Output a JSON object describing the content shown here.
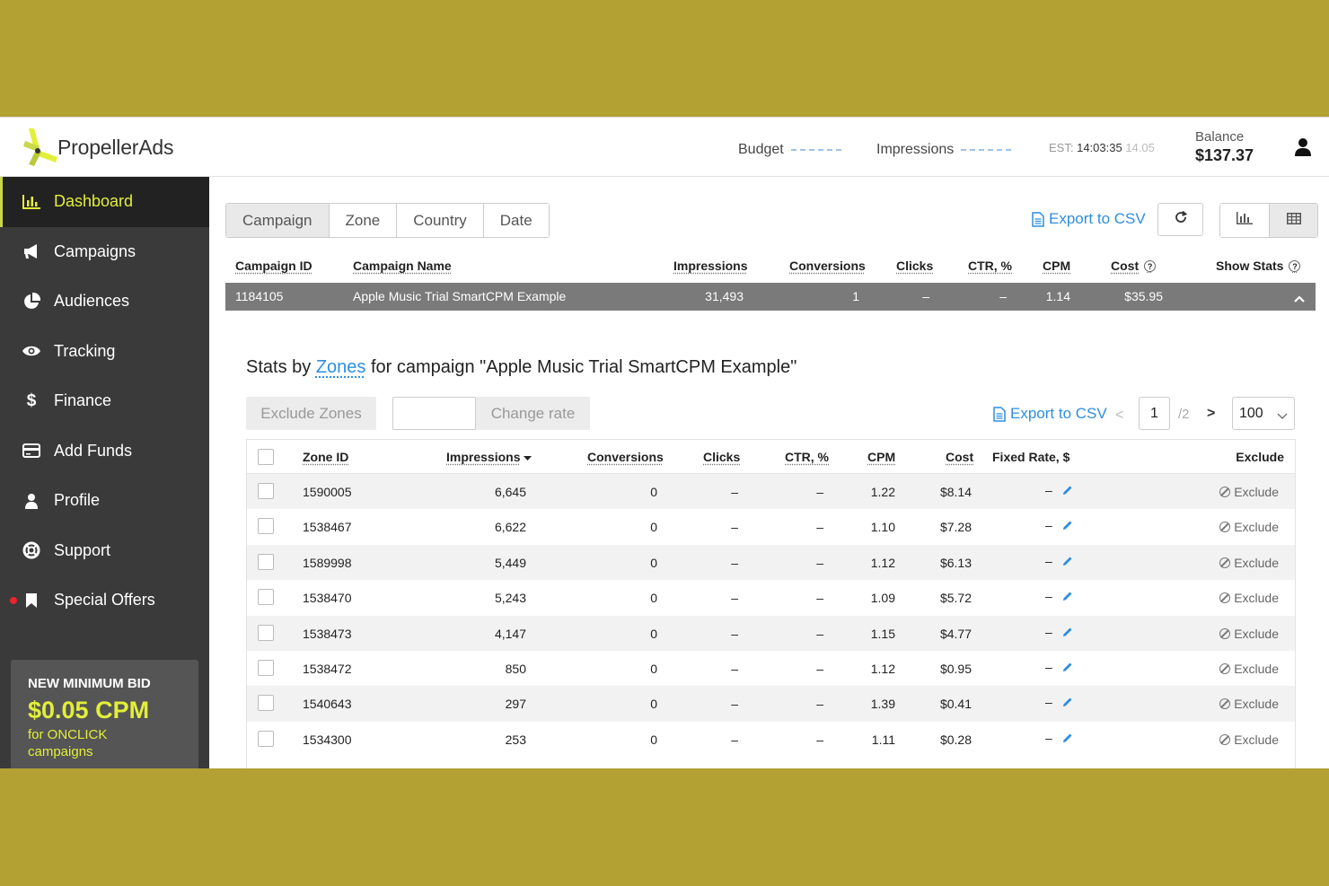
{
  "header": {
    "brand": "PropellerAds",
    "budget_label": "Budget",
    "impressions_label": "Impressions",
    "tz_label": "EST:",
    "time": "14:03:35",
    "date": "14.05",
    "balance_label": "Balance",
    "balance_value": "$137.37"
  },
  "sidebar": {
    "items": [
      {
        "label": "Dashboard",
        "icon": "bar-chart-icon"
      },
      {
        "label": "Campaigns",
        "icon": "megaphone-icon"
      },
      {
        "label": "Audiences",
        "icon": "pie-chart-icon"
      },
      {
        "label": "Tracking",
        "icon": "eye-icon"
      },
      {
        "label": "Finance",
        "icon": "dollar-icon"
      },
      {
        "label": "Add Funds",
        "icon": "credit-card-icon"
      },
      {
        "label": "Profile",
        "icon": "user-icon"
      },
      {
        "label": "Support",
        "icon": "lifebuoy-icon"
      },
      {
        "label": "Special Offers",
        "icon": "bookmark-icon"
      }
    ],
    "promo": {
      "line1": "NEW MINIMUM BID",
      "line2": "$0.05 CPM",
      "line3": "for ONCLICK",
      "line4": "campaigns"
    }
  },
  "toolbar": {
    "tabs": [
      "Campaign",
      "Zone",
      "Country",
      "Date"
    ],
    "active_tab": "Campaign",
    "export_label": "Export to CSV"
  },
  "campaign_table": {
    "headers": {
      "id": "Campaign ID",
      "name": "Campaign Name",
      "impressions": "Impressions",
      "conversions": "Conversions",
      "clicks": "Clicks",
      "ctr": "CTR, %",
      "cpm": "CPM",
      "cost": "Cost",
      "show_stats": "Show Stats",
      "help": "?"
    },
    "row": {
      "id": "1184105",
      "name": "Apple Music Trial SmartCPM Example",
      "impressions": "31,493",
      "conversions": "1",
      "clicks": "–",
      "ctr": "–",
      "cpm": "1.14",
      "cost": "$35.95"
    }
  },
  "stats": {
    "title_prefix": "Stats by",
    "title_link": "Zones",
    "title_suffix": "for campaign \"Apple Music Trial SmartCPM Example\"",
    "exclude_zones_label": "Exclude Zones",
    "rate_value": "",
    "change_rate_label": "Change rate",
    "export_label": "Export to CSV",
    "prev": "<",
    "page": "1",
    "total_pages": "/2",
    "next": ">",
    "per_page": "100"
  },
  "zone_table": {
    "headers": {
      "zone_id": "Zone ID",
      "impressions": "Impressions",
      "conversions": "Conversions",
      "clicks": "Clicks",
      "ctr": "CTR, %",
      "cpm": "CPM",
      "cost": "Cost",
      "fixed_rate": "Fixed Rate, $",
      "exclude": "Exclude"
    },
    "rows": [
      {
        "zone": "1590005",
        "impressions": "6,645",
        "conversions": "0",
        "clicks": "–",
        "ctr": "–",
        "cpm": "1.22",
        "cost": "$8.14",
        "fixed": "–",
        "action": "Exclude"
      },
      {
        "zone": "1538467",
        "impressions": "6,622",
        "conversions": "0",
        "clicks": "–",
        "ctr": "–",
        "cpm": "1.10",
        "cost": "$7.28",
        "fixed": "–",
        "action": "Exclude"
      },
      {
        "zone": "1589998",
        "impressions": "5,449",
        "conversions": "0",
        "clicks": "–",
        "ctr": "–",
        "cpm": "1.12",
        "cost": "$6.13",
        "fixed": "–",
        "action": "Exclude"
      },
      {
        "zone": "1538470",
        "impressions": "5,243",
        "conversions": "0",
        "clicks": "–",
        "ctr": "–",
        "cpm": "1.09",
        "cost": "$5.72",
        "fixed": "–",
        "action": "Exclude"
      },
      {
        "zone": "1538473",
        "impressions": "4,147",
        "conversions": "0",
        "clicks": "–",
        "ctr": "–",
        "cpm": "1.15",
        "cost": "$4.77",
        "fixed": "–",
        "action": "Exclude"
      },
      {
        "zone": "1538472",
        "impressions": "850",
        "conversions": "0",
        "clicks": "–",
        "ctr": "–",
        "cpm": "1.12",
        "cost": "$0.95",
        "fixed": "–",
        "action": "Exclude"
      },
      {
        "zone": "1540643",
        "impressions": "297",
        "conversions": "0",
        "clicks": "–",
        "ctr": "–",
        "cpm": "1.39",
        "cost": "$0.41",
        "fixed": "–",
        "action": "Exclude"
      },
      {
        "zone": "1534300",
        "impressions": "253",
        "conversions": "0",
        "clicks": "–",
        "ctr": "–",
        "cpm": "1.11",
        "cost": "$0.28",
        "fixed": "–",
        "action": "Exclude"
      }
    ]
  },
  "colors": {
    "frame": "#b3a133",
    "sidebar": "#3a3a3a",
    "accent_yellow": "#e2ef3a",
    "link_blue": "#2e8ee0",
    "campaign_row": "#7a7a7a",
    "offer_dot": "#e8242f"
  }
}
